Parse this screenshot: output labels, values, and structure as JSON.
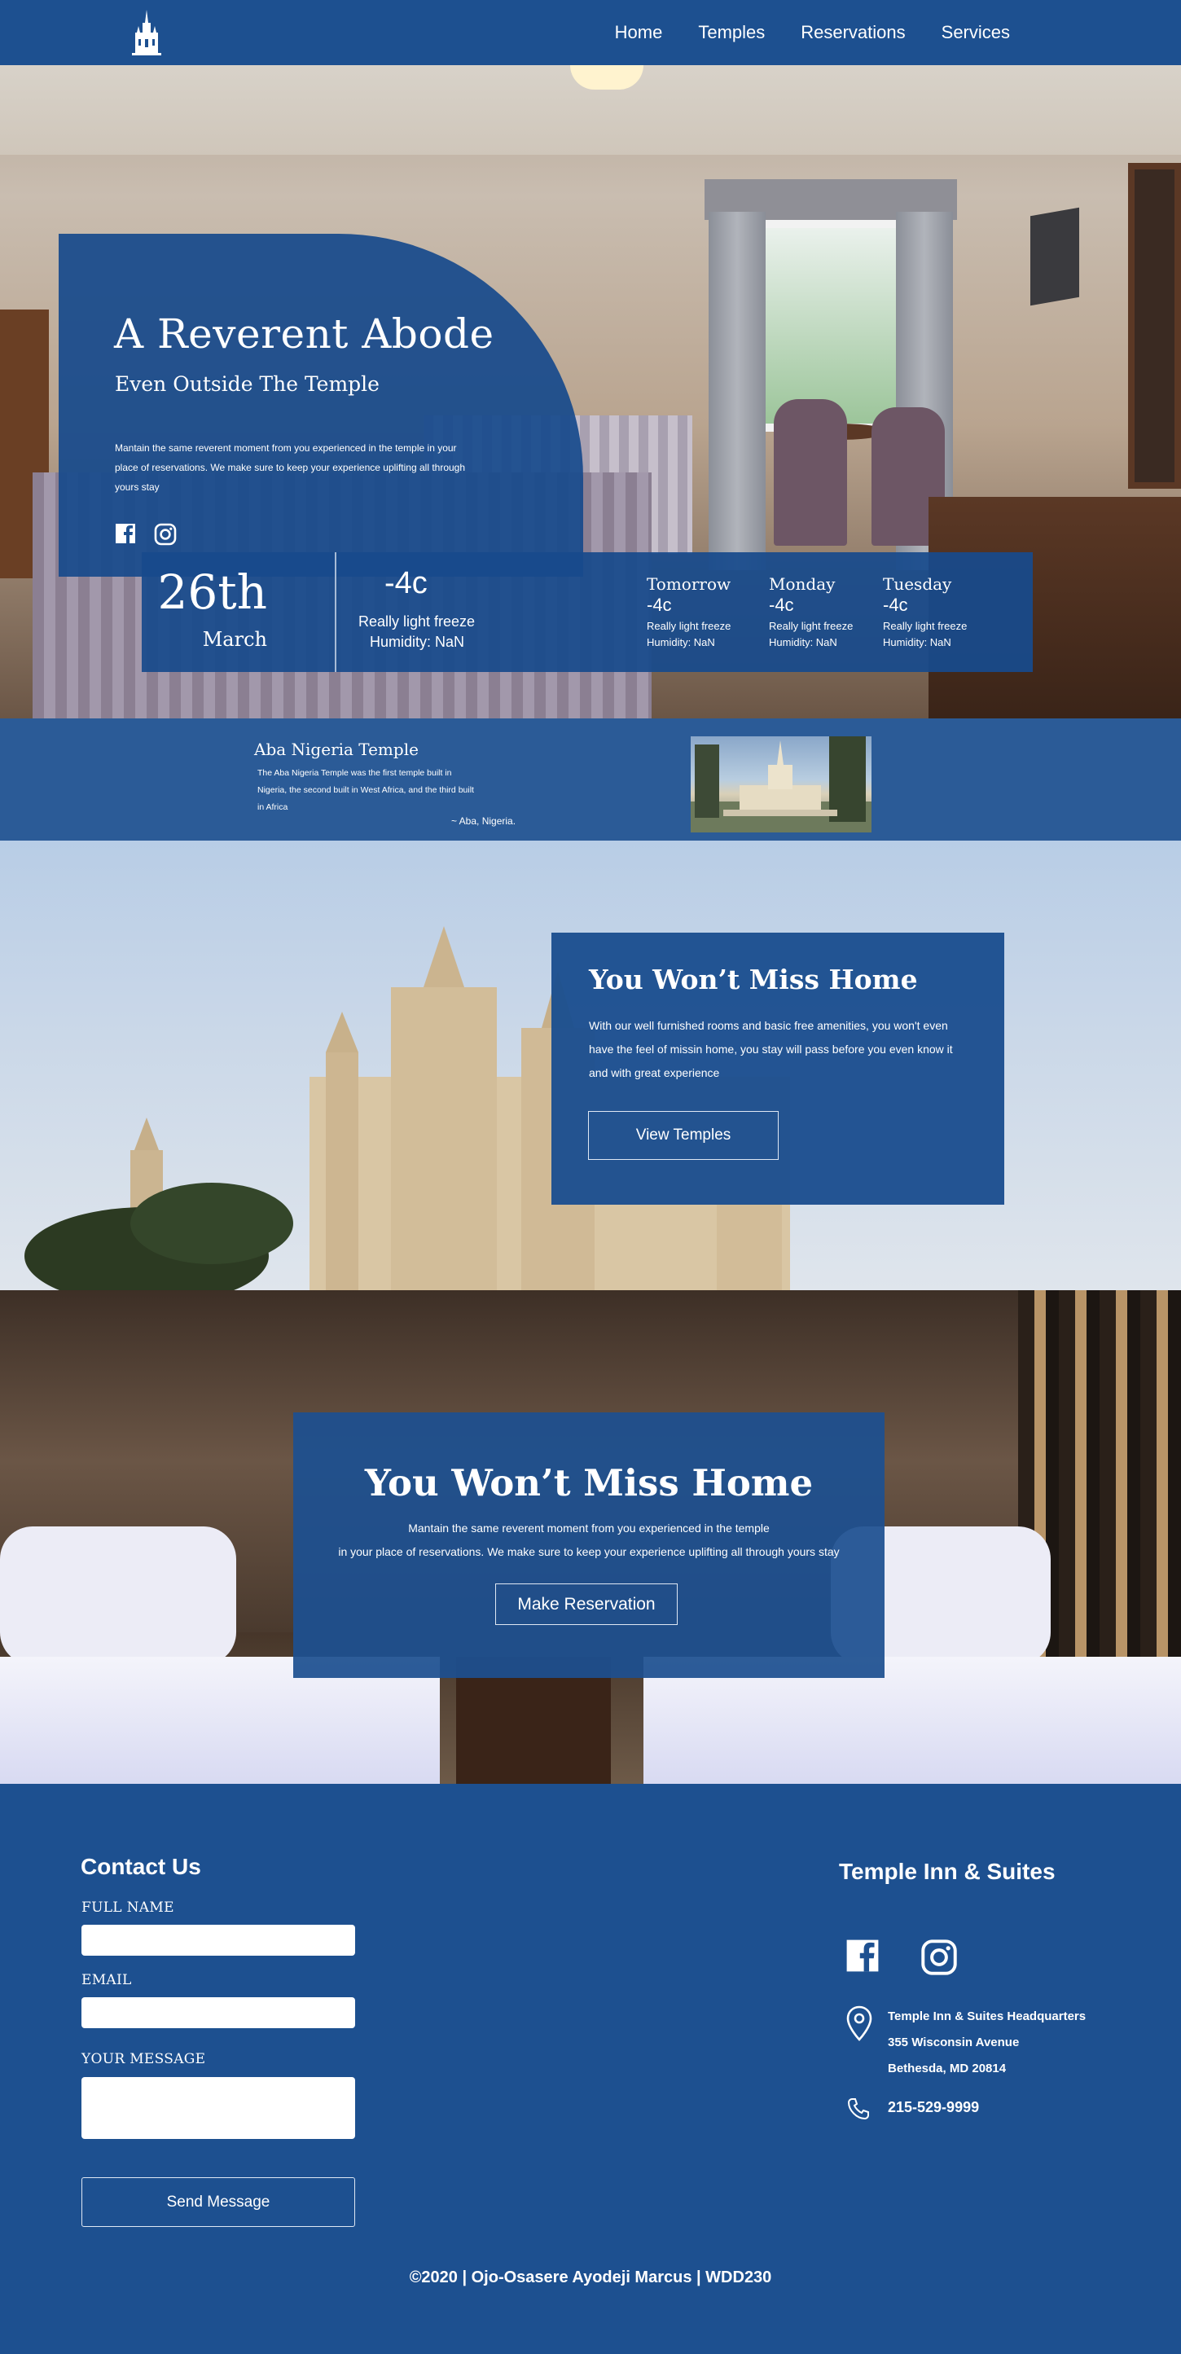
{
  "nav": {
    "logo_icon": "temple-logo-icon",
    "links": [
      "Home",
      "Temples",
      "Reservations",
      "Services"
    ]
  },
  "hero": {
    "title": "A Reverent Abode",
    "subtitle": "Even Outside The Temple",
    "text": "Mantain the same reverent moment from you experienced in the temple in your place of reservations. We make sure to keep your experience uplifting all through yours stay",
    "social_icons": [
      "facebook-icon",
      "instagram-icon"
    ]
  },
  "weather": {
    "day": "26th",
    "month": "March",
    "temp": "-4c",
    "desc": "Really light freeze",
    "humidity": "Humidity: NaN",
    "forecast": [
      {
        "day": "Tomorrow",
        "temp": "-4c",
        "desc": "Really light freeze",
        "humidity": "Humidity: NaN"
      },
      {
        "day": "Monday",
        "temp": "-4c",
        "desc": "Really light freeze",
        "humidity": "Humidity: NaN"
      },
      {
        "day": "Tuesday",
        "temp": "-4c",
        "desc": "Really light freeze",
        "humidity": "Humidity: NaN"
      }
    ]
  },
  "temple_strip": {
    "name": "Aba Nigeria Temple",
    "text": "The Aba Nigeria Temple was the first temple built in Nigeria, the second built in West Africa, and the third built in Africa",
    "location": "~ Aba, Nigeria."
  },
  "temples_section": {
    "title": "You Won’t Miss Home",
    "text": "With our well furnished rooms and basic free amenities, you won't even have the feel of missin home, you stay will pass before you even know it and with great experience",
    "button": "View Temples"
  },
  "reservation_section": {
    "title": "You Won’t Miss Home",
    "text_line1": "Mantain the same reverent moment from you experienced in the temple",
    "text_line2": "in your place of reservations. We make sure to keep your experience uplifting all through yours stay",
    "button": "Make Reservation"
  },
  "footer": {
    "contact_title": "Contact Us",
    "full_name_label": "FULL NAME",
    "email_label": "EMAIL",
    "message_label": "YOUR MESSAGE",
    "full_name_value": "",
    "email_value": "",
    "message_value": "",
    "send_button": "Send Message",
    "brand": "Temple Inn & Suites",
    "address_line1": "Temple Inn & Suites Headquarters",
    "address_line2": "355 Wisconsin Avenue",
    "address_line3": "Bethesda, MD 20814",
    "phone": "215-529-9999",
    "copyright": "©2020 | Ojo-Osasere Ayodeji Marcus | WDD230"
  },
  "colors": {
    "brand_blue": "#1d5090",
    "strip_blue": "#2b5b97"
  }
}
